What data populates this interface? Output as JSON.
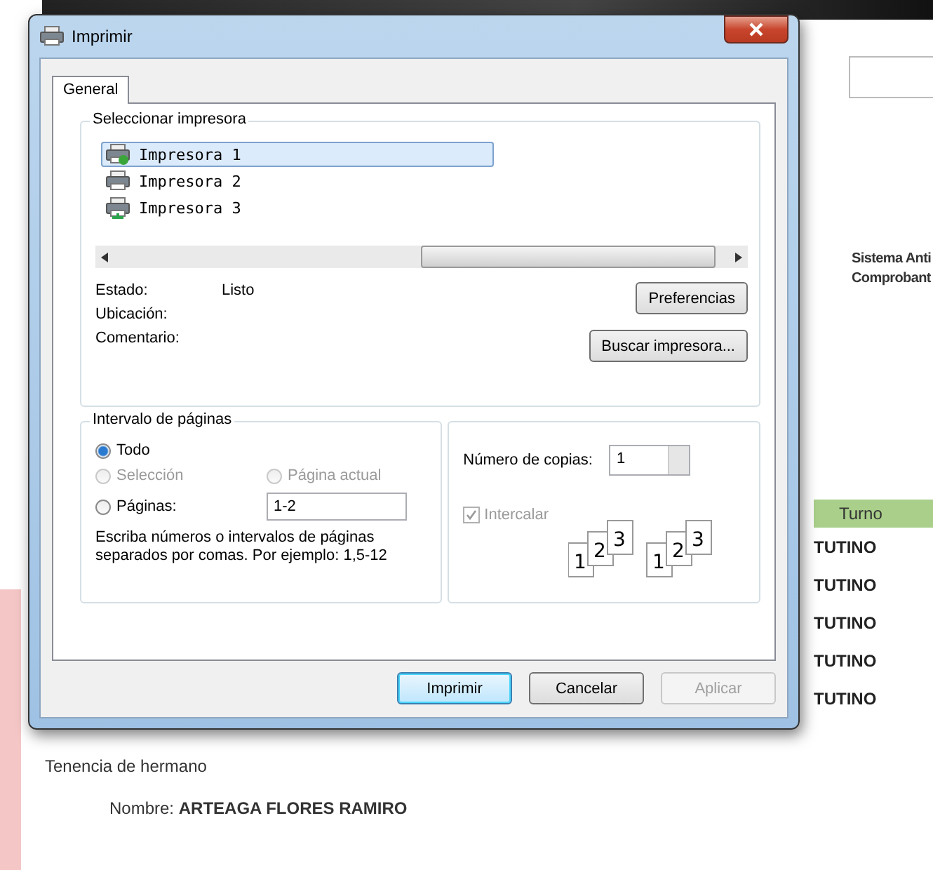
{
  "background": {
    "header_lines": [
      "Sistema Anti",
      "Comprobant"
    ],
    "table": {
      "columns": [
        "Turno"
      ],
      "rows": [
        "TUTINO",
        "TUTINO",
        "TUTINO",
        "TUTINO",
        "TUTINO"
      ]
    },
    "section_title": "Tenencia de hermano",
    "name_label": "Nombre:",
    "name_value": "ARTEAGA FLORES RAMIRO"
  },
  "dialog": {
    "title": "Imprimir",
    "tabs": [
      {
        "label": "General",
        "selected": true
      }
    ],
    "printer_group": {
      "title": "Seleccionar impresora",
      "printers": [
        {
          "name": "Impresora 1",
          "kind": "default",
          "selected": true
        },
        {
          "name": "Impresora 2",
          "kind": "plain",
          "selected": false
        },
        {
          "name": "Impresora 3",
          "kind": "network",
          "selected": false
        }
      ],
      "info": [
        {
          "label": "Estado:",
          "value": "Listo"
        },
        {
          "label": "Ubicación:"
        },
        {
          "label": "Comentario:"
        }
      ],
      "buttons": [
        "Preferencias",
        "Buscar impresora..."
      ]
    },
    "range_group": {
      "title": "Intervalo de páginas",
      "options": [
        {
          "label": "Todo",
          "selected": true,
          "disabled": false
        },
        {
          "label": "Selección",
          "selected": false,
          "disabled": true
        },
        {
          "label": "Página actual",
          "selected": false,
          "disabled": true
        },
        {
          "label": "Páginas:",
          "selected": false,
          "disabled": false,
          "value": "1-2"
        }
      ],
      "hint": "Escriba números o intervalos de páginas separados por comas. Por ejemplo: 1,5-12"
    },
    "copies_group": {
      "label": "Número de copias:",
      "value": "1",
      "collate": {
        "label": "Intercalar",
        "checked": true,
        "disabled": true
      },
      "stacks": [
        [
          "1",
          "2",
          "3"
        ],
        [
          "1",
          "2",
          "3"
        ]
      ]
    },
    "buttons": [
      {
        "label": "Imprimir",
        "default": true,
        "disabled": false
      },
      {
        "label": "Cancelar",
        "default": false,
        "disabled": false
      },
      {
        "label": "Aplicar",
        "default": false,
        "disabled": true
      }
    ]
  }
}
